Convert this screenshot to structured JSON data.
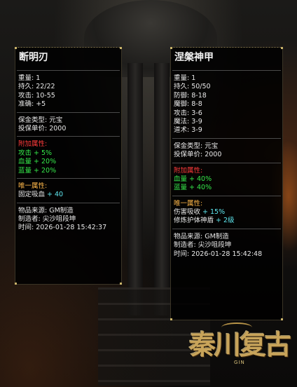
{
  "left_item": {
    "name": "断明刃",
    "stats": [
      "重量: 1",
      "持久: 22/22",
      "攻击: 10-55",
      "准确: +5"
    ],
    "insure": [
      "保金类型: 元宝",
      "投保单价: 2000"
    ],
    "extra_title": "附加属性:",
    "extra": [
      {
        "label": "攻击",
        "value": " + 5%"
      },
      {
        "label": "血量",
        "value": " + 20%"
      },
      {
        "label": "蓝量",
        "value": " + 20%"
      }
    ],
    "unique_title": "唯一属性:",
    "unique": [
      {
        "label": "固定吸血",
        "value": " + 40"
      }
    ],
    "source": [
      "物品来源: GM制造",
      "制造者: 尖沙咀段坤",
      "时间: 2026-01-28 15:42:37"
    ]
  },
  "right_item": {
    "name": "涅槃神甲",
    "stats": [
      "重量: 1",
      "持久: 50/50",
      "防御: 8-18",
      "魔御: 8-8",
      "攻击: 3-6",
      "魔法: 3-9",
      "道术: 3-9"
    ],
    "insure": [
      "保金类型: 元宝",
      "投保单价: 2000"
    ],
    "extra_title": "附加属性:",
    "extra": [
      {
        "label": "血量",
        "value": " + 40%"
      },
      {
        "label": "蓝量",
        "value": " + 40%"
      }
    ],
    "unique_title": "唯一属性:",
    "unique": [
      {
        "label": "伤害吸收",
        "value": " + 15%"
      },
      {
        "label": "修炼护体神盾",
        "value": " + 2级"
      }
    ],
    "source": [
      "物品来源: GM制造",
      "制造者: 尖沙咀段坤",
      "时间: 2026-01-28 15:42:48"
    ]
  },
  "logo": {
    "text": "秦川复古",
    "sub": "GIN"
  },
  "colors": {
    "red": "#ff3b3b",
    "green": "#35e84a",
    "cyan": "#5fe8f0",
    "orange": "#ffb84a"
  }
}
